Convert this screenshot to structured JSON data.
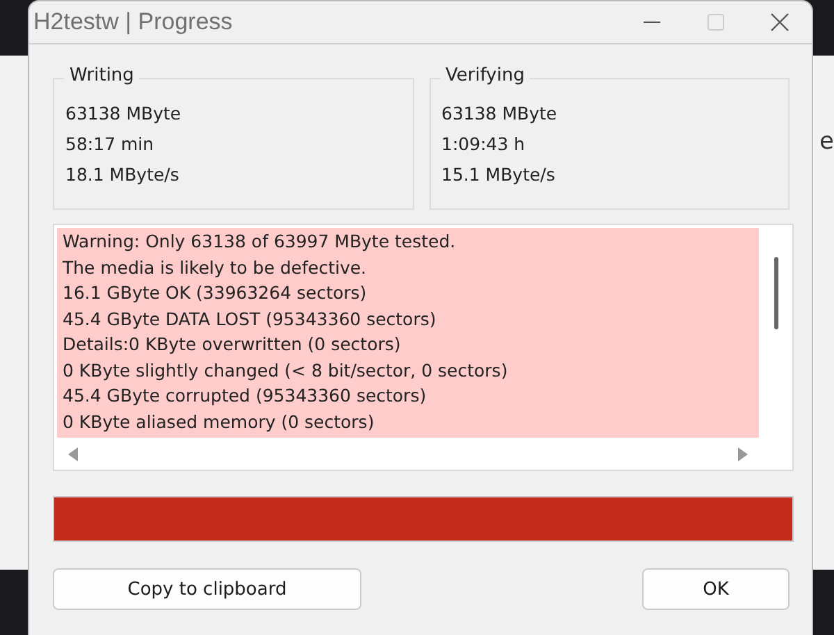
{
  "window": {
    "title": "H2testw | Progress"
  },
  "back_window": {
    "text_fragment": "e"
  },
  "groups": [
    {
      "title": "Writing",
      "lines": [
        "63138 MByte",
        "58:17 min",
        "18.1 MByte/s"
      ]
    },
    {
      "title": "Verifying",
      "lines": [
        "63138 MByte",
        "1:09:43 h",
        "15.1 MByte/s"
      ]
    }
  ],
  "log": {
    "lines": [
      "Warning: Only 63138 of 63997 MByte tested.",
      "The media is likely to be defective.",
      "16.1 GByte OK (33963264 sectors)",
      "45.4 GByte DATA LOST (95343360 sectors)",
      "Details:0 KByte overwritten (0 sectors)",
      "0 KByte slightly changed (< 8 bit/sector, 0 sectors)",
      "45.4 GByte corrupted (95343360 sectors)",
      "0 KByte aliased memory (0 sectors)"
    ]
  },
  "progress": {
    "level": 1,
    "color": "#c42b1c"
  },
  "buttons": [
    "Copy to clipboard",
    "OK"
  ]
}
